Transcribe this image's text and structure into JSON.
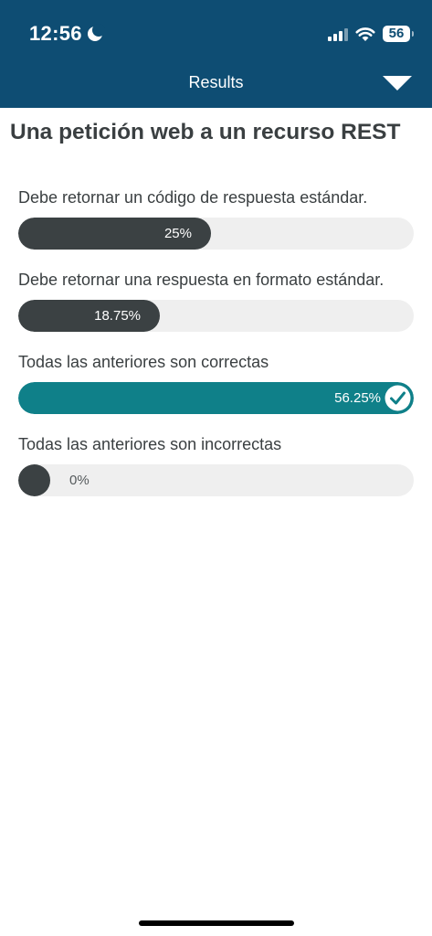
{
  "status_bar": {
    "time": "12:56",
    "battery": "56",
    "icons": [
      "moon-icon",
      "cellular-signal-icon",
      "wifi-icon",
      "battery-icon"
    ]
  },
  "nav": {
    "title": "Results",
    "dropdown_icon": "triangle-down-icon"
  },
  "question": {
    "title": "Una petición web a un recurso REST"
  },
  "options": [
    {
      "label": "Debe retornar un código de respuesta estándar.",
      "percent_label": "25%",
      "fraction": 0.25,
      "correct": false
    },
    {
      "label": "Debe retornar una respuesta en formato estándar.",
      "percent_label": "18.75%",
      "fraction": 0.1875,
      "correct": false
    },
    {
      "label": "Todas las anteriores son correctas",
      "percent_label": "56.25%",
      "fraction": 0.5625,
      "correct": true
    },
    {
      "label": "Todas las anteriores son incorrectas",
      "percent_label": "0%",
      "fraction": 0,
      "correct": false
    }
  ],
  "colors": {
    "header_bg": "#0e4d73",
    "bar_fill": "#3b4143",
    "bar_fill_correct": "#0f8089",
    "bar_track": "#efefef"
  }
}
